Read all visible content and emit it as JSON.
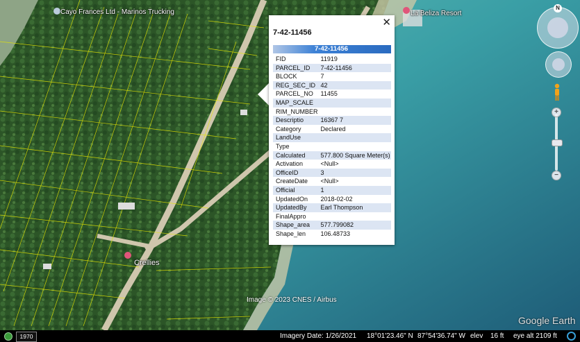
{
  "places": [
    {
      "name": "Cayo Frances Ltd - Marinos Trucking",
      "pin_color": "#bcd"
    },
    {
      "name": "La Beliza Resort",
      "pin_color": "#e0557a"
    },
    {
      "name": "Crellies",
      "pin_color": "#e0557a"
    }
  ],
  "popup": {
    "title": "7-42-11456",
    "header": "7-42-11456",
    "close_glyph": "✕",
    "fields": [
      {
        "key": "FID",
        "value": "11919"
      },
      {
        "key": "PARCEL_ID",
        "value": "7-42-11456"
      },
      {
        "key": "BLOCK",
        "value": "7"
      },
      {
        "key": "REG_SEC_ID",
        "value": "42"
      },
      {
        "key": "PARCEL_NO",
        "value": "11455"
      },
      {
        "key": "MAP_SCALE",
        "value": ""
      },
      {
        "key": "RIM_NUMBER",
        "value": ""
      },
      {
        "key": "Descriptio",
        "value": "16367 7"
      },
      {
        "key": "Category",
        "value": "Declared"
      },
      {
        "key": "LandUse",
        "value": ""
      },
      {
        "key": "Type",
        "value": ""
      },
      {
        "key": "Calculated",
        "value": "577.800 Square Meter(s)"
      },
      {
        "key": "Activation",
        "value": "<Null>"
      },
      {
        "key": "OfficeID",
        "value": "3"
      },
      {
        "key": "CreateDate",
        "value": "<Null>"
      },
      {
        "key": "Official",
        "value": "1"
      },
      {
        "key": "UpdatedOn",
        "value": "2018-02-02"
      },
      {
        "key": "UpdatedBy",
        "value": "Earl Thompson"
      },
      {
        "key": "FinalAppro",
        "value": ""
      },
      {
        "key": "Shape_area",
        "value": "577.799082"
      },
      {
        "key": "Shape_len",
        "value": "106.48733"
      }
    ]
  },
  "navigation": {
    "compass_north": "N",
    "zoom_in": "+",
    "zoom_out": "−"
  },
  "copyright": "Image © 2023 CNES / Airbus",
  "watermark": "Google Earth",
  "status_bar": {
    "historical_year": "1970",
    "imagery_date": "Imagery Date: 1/26/2021",
    "latitude": "18°01'23.46\" N",
    "longitude": "87°54'36.74\" W",
    "elev_label": "elev",
    "elev_value": "16 ft",
    "eye_alt": "eye alt  2109 ft"
  },
  "colors": {
    "parcel_lines": "#e6e600",
    "vegetation": "#2f5a2a",
    "sea_shallow": "#4fb0a8",
    "sea_deep": "#1f5e78",
    "road": "#c8bfa8",
    "popup_header": "#2a6bc0"
  }
}
